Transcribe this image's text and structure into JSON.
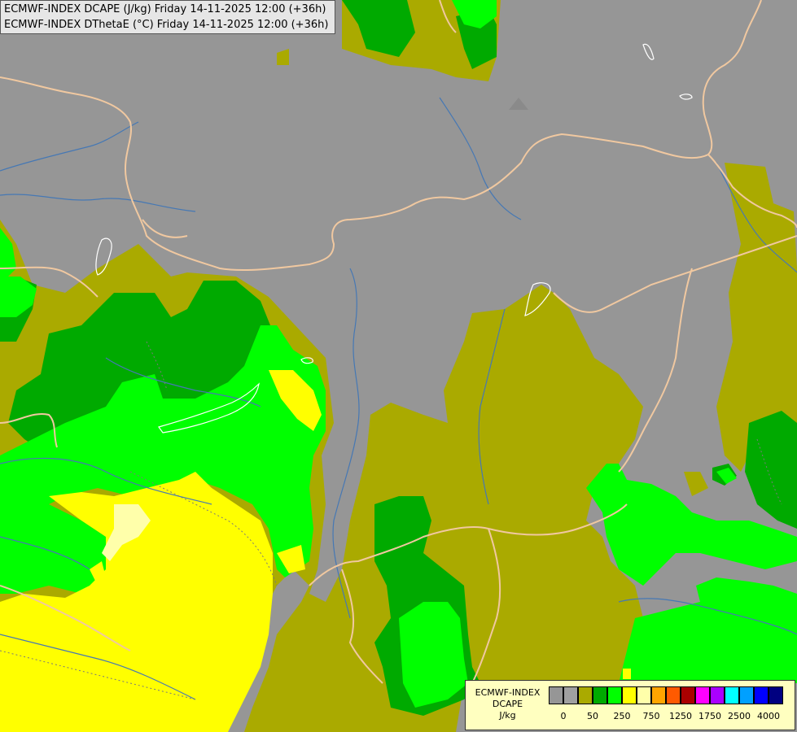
{
  "header": {
    "line1": "ECMWF-INDEX DCAPE (J/kg) Friday 14-11-2025 12:00 (+36h)",
    "line2": "ECMWF-INDEX DThetaE (°C) Friday 14-11-2025 12:00 (+36h)"
  },
  "legend": {
    "title_line1": "ECMWF-INDEX",
    "title_line2": "DCAPE",
    "unit": "J/kg",
    "colors": [
      "#969696",
      "#a0a0a0",
      "#aaaa00",
      "#00aa00",
      "#00ff00",
      "#ffff00",
      "#ffffaa",
      "#ffa500",
      "#ff5a00",
      "#aa0000",
      "#ff00ff",
      "#aa00ff",
      "#00ffff",
      "#00a0ff",
      "#0000ff",
      "#000080"
    ],
    "ticks": [
      "0",
      "50",
      "250",
      "750",
      "1250",
      "1750",
      "2500",
      "4000"
    ]
  },
  "map_colors": {
    "background": "#969696",
    "olive": "#aaaa00",
    "dark_green": "#00aa00",
    "green": "#00ff00",
    "yellow": "#ffff00",
    "pale_yellow": "#ffffaa",
    "border": "#f0c8a0",
    "river": "#4678b4"
  }
}
